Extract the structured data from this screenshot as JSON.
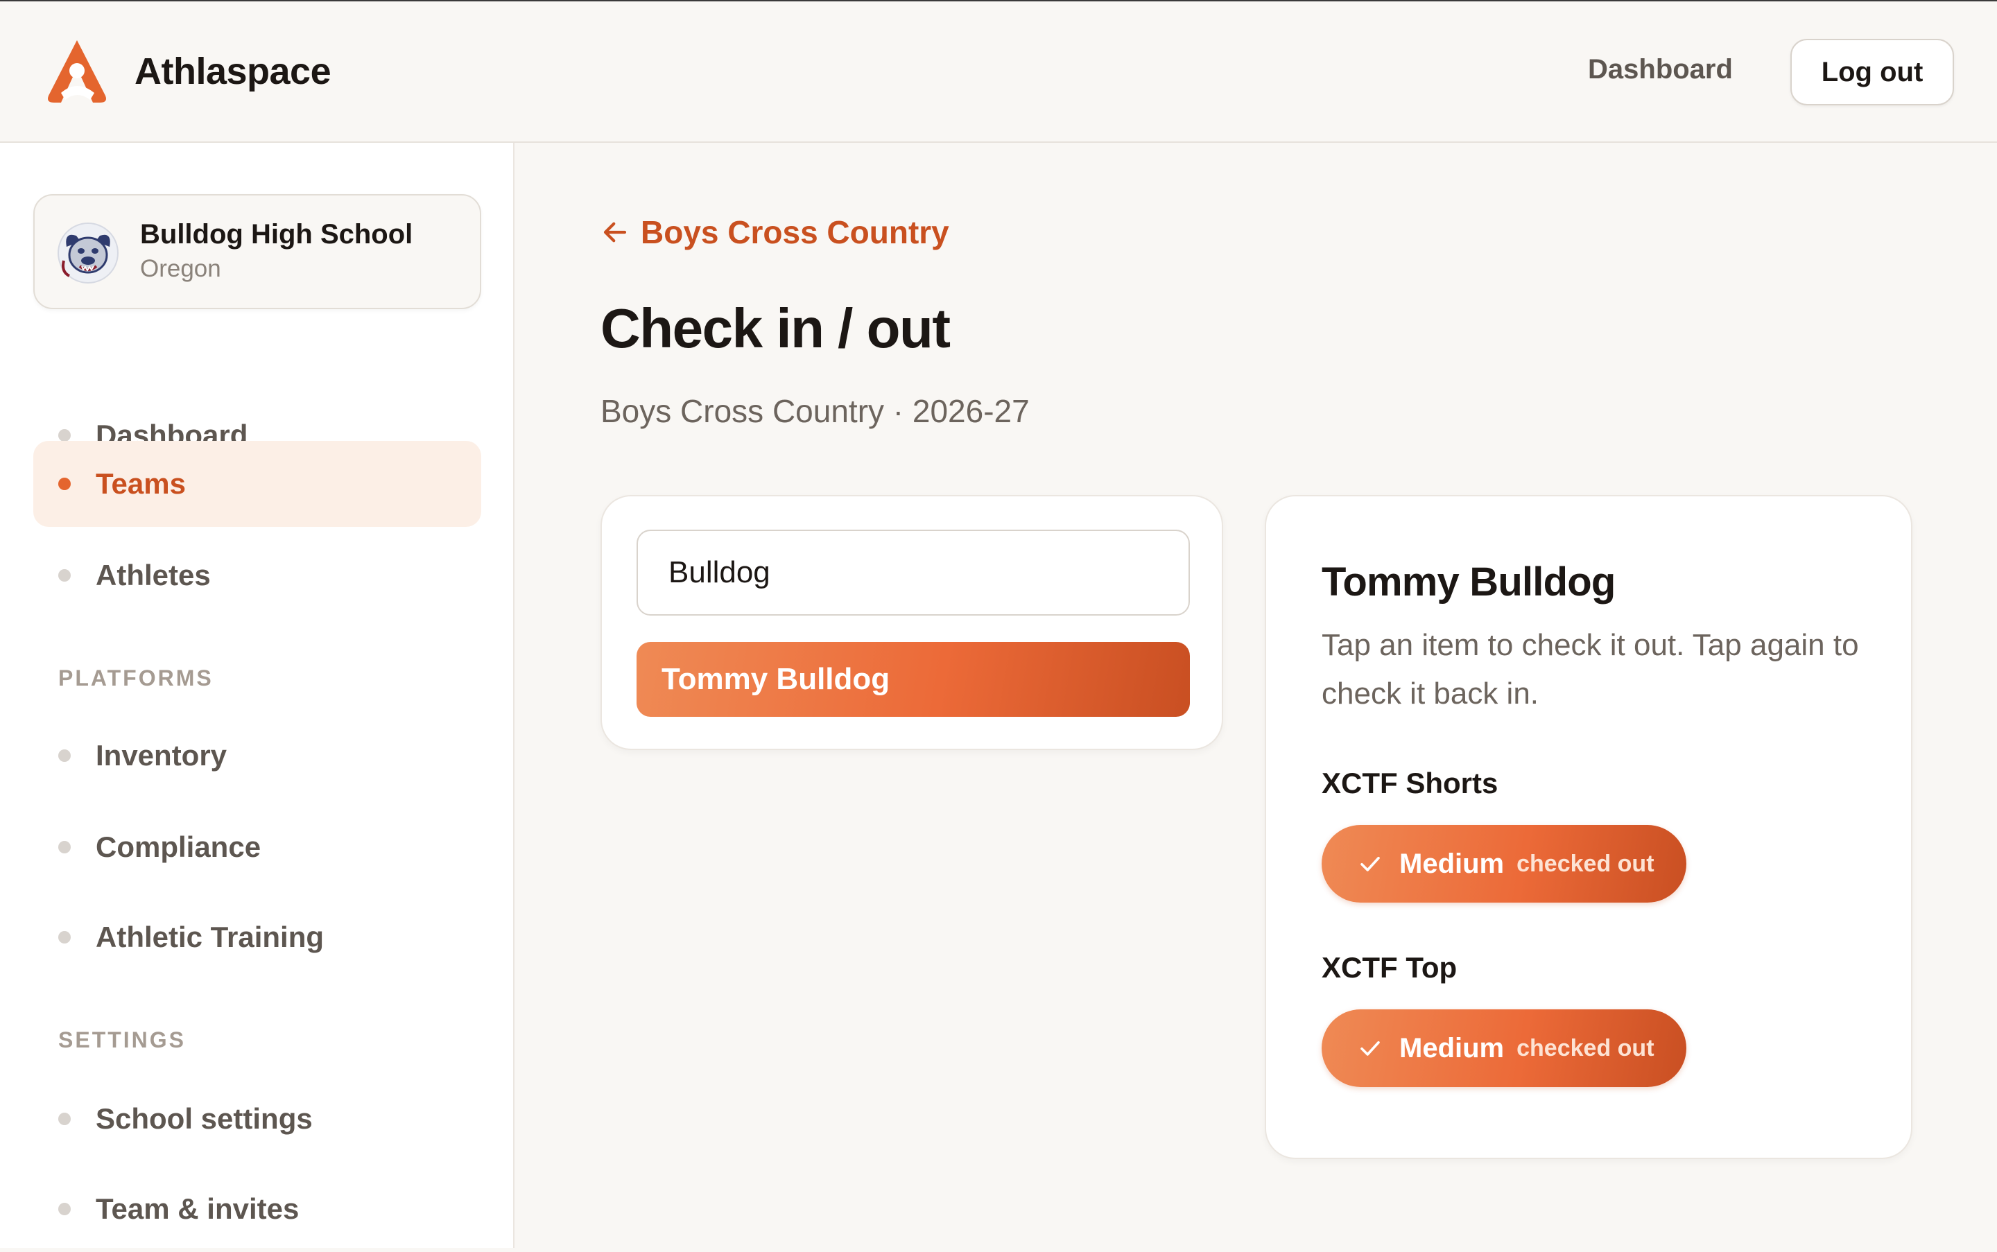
{
  "header": {
    "brand_name": "Athlaspace",
    "nav_dashboard": "Dashboard",
    "logout_label": "Log out"
  },
  "sidebar": {
    "school": {
      "name": "Bulldog High School",
      "region": "Oregon"
    },
    "main_items": [
      {
        "label": "Dashboard",
        "active": false
      },
      {
        "label": "Teams",
        "active": true
      },
      {
        "label": "Athletes",
        "active": false
      }
    ],
    "platforms_heading": "PLATFORMS",
    "platform_items": [
      {
        "label": "Inventory"
      },
      {
        "label": "Compliance"
      },
      {
        "label": "Athletic Training"
      }
    ],
    "settings_heading": "SETTINGS",
    "settings_items": [
      {
        "label": "School settings"
      },
      {
        "label": "Team & invites"
      }
    ]
  },
  "main": {
    "back_label": "Boys Cross Country",
    "title": "Check in / out",
    "subtitle": "Boys Cross Country · 2026-27",
    "search": {
      "value": "Bulldog",
      "placeholder": ""
    },
    "results": [
      {
        "name": "Tommy Bulldog"
      }
    ],
    "athlete": {
      "name": "Tommy Bulldog",
      "help": "Tap an item to check it out. Tap again to check it back in.",
      "items": [
        {
          "title": "XCTF Shorts",
          "size": "Medium",
          "status": "checked out"
        },
        {
          "title": "XCTF Top",
          "size": "Medium",
          "status": "checked out"
        }
      ]
    }
  },
  "colors": {
    "accent": "#e4652e",
    "accent_dark": "#c9501f",
    "active_bg": "#fcefe6",
    "page_bg": "#f9f7f4"
  },
  "icons": {
    "brand": "athlaspace-logo-icon",
    "school": "bulldog-mascot-icon",
    "back": "arrow-left-icon",
    "item_state": "check-icon",
    "nav": "dot-icon"
  }
}
